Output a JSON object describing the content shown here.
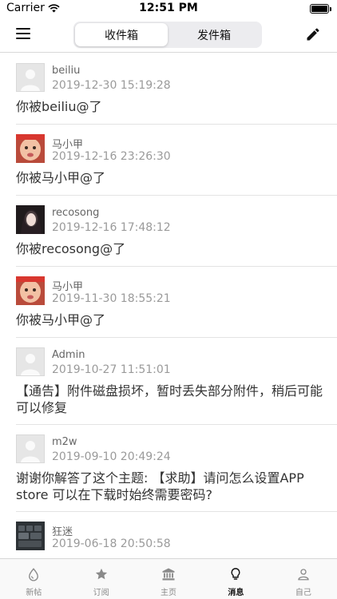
{
  "status_bar": {
    "carrier": "Carrier",
    "time": "12:51 PM"
  },
  "nav": {
    "tabs": [
      "收件箱",
      "发件箱"
    ],
    "active_tab": 0
  },
  "messages": [
    {
      "name": "beiliu",
      "time": "2019-12-30 15:19:28",
      "content": "你被beiliu@了",
      "avatar": "default-avatar"
    },
    {
      "name": "马小甲",
      "time": "2019-12-16 23:26:30",
      "content": "你被马小甲@了",
      "avatar": "baby-photo-avatar"
    },
    {
      "name": "recosong",
      "time": "2019-12-16 17:48:12",
      "content": "你被recosong@了",
      "avatar": "dark-portrait-avatar"
    },
    {
      "name": "马小甲",
      "time": "2019-11-30 18:55:21",
      "content": "你被马小甲@了",
      "avatar": "baby-photo-avatar"
    },
    {
      "name": "Admin",
      "time": "2019-10-27 11:51:01",
      "content": "【通告】附件磁盘损坏，暂时丢失部分附件，稍后可能可以修复",
      "avatar": "default-avatar"
    },
    {
      "name": "m2w",
      "time": "2019-09-10 20:49:24",
      "content": "谢谢你解答了这个主题: 【求助】请问怎么设置APP store 可以在下载时始终需要密码?",
      "avatar": "default-avatar"
    },
    {
      "name": "狂迷",
      "time": "2019-06-18 20:50:58",
      "content": "",
      "avatar": "keyboard-photo-avatar"
    }
  ],
  "tab_bar": [
    {
      "label": "新帖",
      "icon": "droplet-icon"
    },
    {
      "label": "订阅",
      "icon": "star-icon"
    },
    {
      "label": "主页",
      "icon": "bank-icon"
    },
    {
      "label": "消息",
      "icon": "lightbulb-icon"
    },
    {
      "label": "自己",
      "icon": "person-icon"
    }
  ],
  "active_tab": 3,
  "colors": {
    "accent": "#111111",
    "divider": "#e3e3e3",
    "timestamp": "#9a9a9a"
  }
}
